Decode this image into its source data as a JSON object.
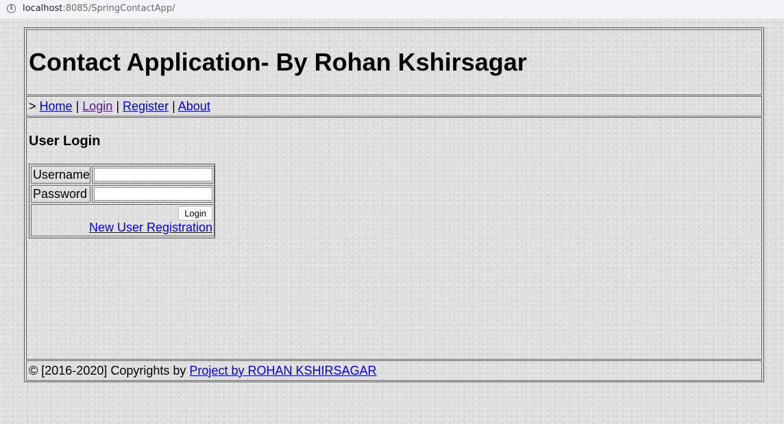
{
  "browser": {
    "url_host": "localhost",
    "url_rest": ":8085/SpringContactApp/"
  },
  "header": {
    "title": "Contact Application- By Rohan Kshirsagar"
  },
  "nav": {
    "prefix": ">",
    "separator": "|",
    "items": [
      {
        "label": "Home",
        "visited": false
      },
      {
        "label": "Login",
        "visited": true
      },
      {
        "label": "Register",
        "visited": false
      },
      {
        "label": "About",
        "visited": false
      }
    ]
  },
  "login": {
    "heading": "User Login",
    "username_label": "Username",
    "username_value": "",
    "password_label": "Password",
    "password_value": "",
    "submit_label": "Login",
    "register_link": "New User Registration"
  },
  "footer": {
    "copyright": "© [2016-2020] Copyrights by",
    "link": "Project by ROHAN KSHIRSAGAR"
  },
  "colors": {
    "link": "#0000ee",
    "visited_link": "#551a8b",
    "background": "#dedede"
  }
}
